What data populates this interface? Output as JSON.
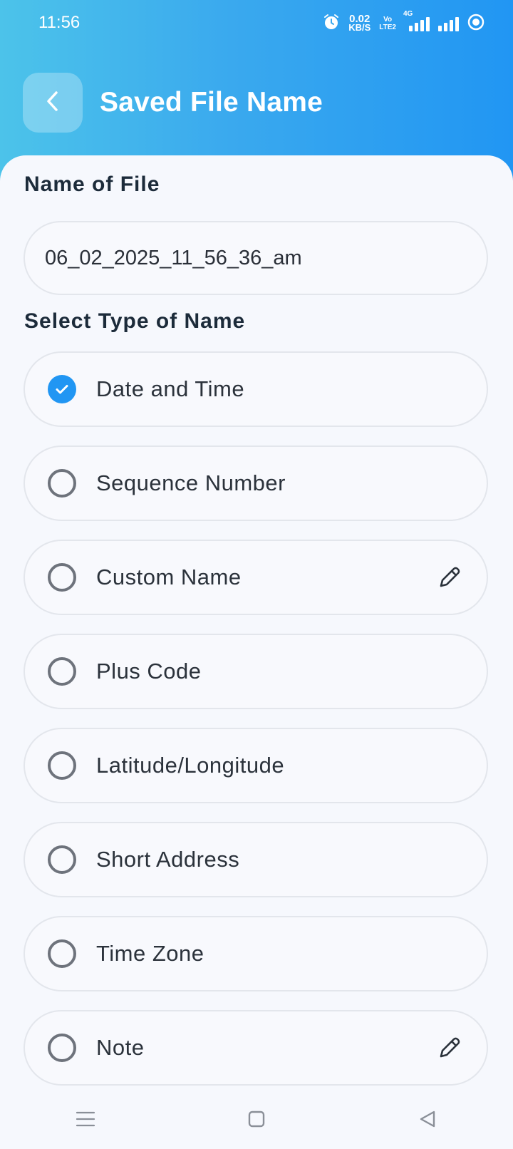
{
  "status_bar": {
    "time": "11:56",
    "net_speed_value": "0.02",
    "net_speed_unit": "KB/S",
    "volte_top": "Vo",
    "volte_bottom": "LTE2",
    "network_label": "4G",
    "icons": [
      "alarm-icon",
      "volte-icon",
      "signal-icon",
      "signal-icon",
      "hotspot-icon"
    ]
  },
  "header": {
    "title": "Saved File Name",
    "back_icon": "chevron-left-icon",
    "colors": {
      "gradient_start": "#4cc3ea",
      "gradient_end": "#2196f3"
    }
  },
  "file_name": {
    "label": "Name of File",
    "value": "06_02_2025_11_56_36_am"
  },
  "name_type": {
    "label": "Select Type of Name",
    "options": [
      {
        "label": "Date and Time",
        "selected": true,
        "editable": false
      },
      {
        "label": "Sequence Number",
        "selected": false,
        "editable": false
      },
      {
        "label": "Custom Name",
        "selected": false,
        "editable": true
      },
      {
        "label": "Plus Code",
        "selected": false,
        "editable": false
      },
      {
        "label": "Latitude/Longitude",
        "selected": false,
        "editable": false
      },
      {
        "label": "Short Address",
        "selected": false,
        "editable": false
      },
      {
        "label": "Time Zone",
        "selected": false,
        "editable": false
      },
      {
        "label": "Note",
        "selected": false,
        "editable": true
      }
    ],
    "accent_color": "#2196f3"
  },
  "nav_bar": {
    "icons": [
      "menu-icon",
      "home-icon",
      "back-icon"
    ]
  }
}
